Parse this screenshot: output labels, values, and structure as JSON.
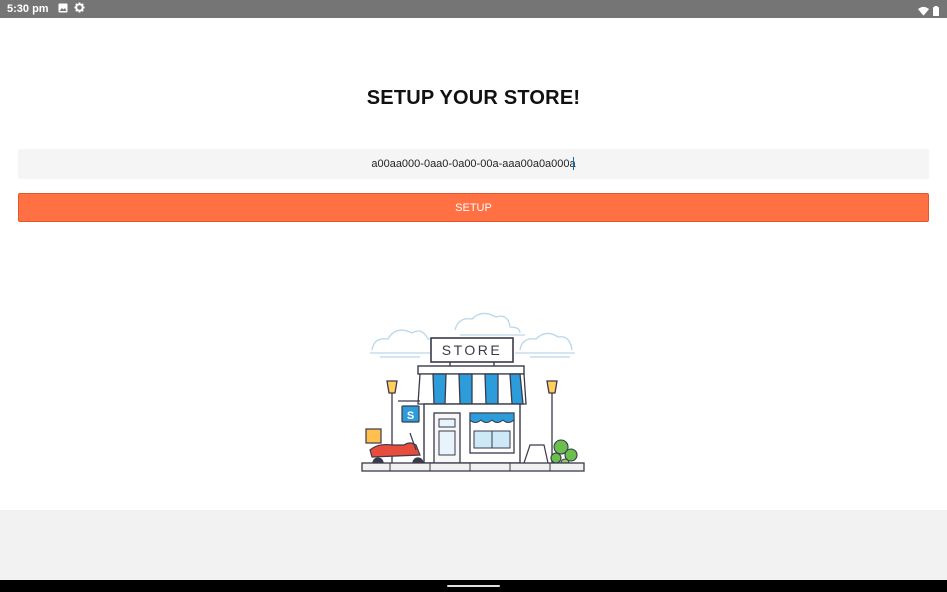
{
  "status_bar": {
    "time": "5:30 pm",
    "left_icons": [
      "image-icon",
      "gear-icon"
    ],
    "right_icons": [
      "wifi-icon",
      "battery-icon"
    ]
  },
  "page": {
    "title": "SETUP YOUR STORE!"
  },
  "store_id_input": {
    "value": "a00aa000-0aa0-0a00-00a-aaa00a0a000a"
  },
  "setup_button": {
    "label": "SETUP"
  },
  "illustration": {
    "sign_text": "STORE",
    "badge_letter": "S",
    "icon": "storefront-illustration"
  },
  "colors": {
    "accent": "#ff7043",
    "status_bar": "#757575",
    "input_bg": "#f5f5f5",
    "awning_blue": "#2d9cdb"
  }
}
